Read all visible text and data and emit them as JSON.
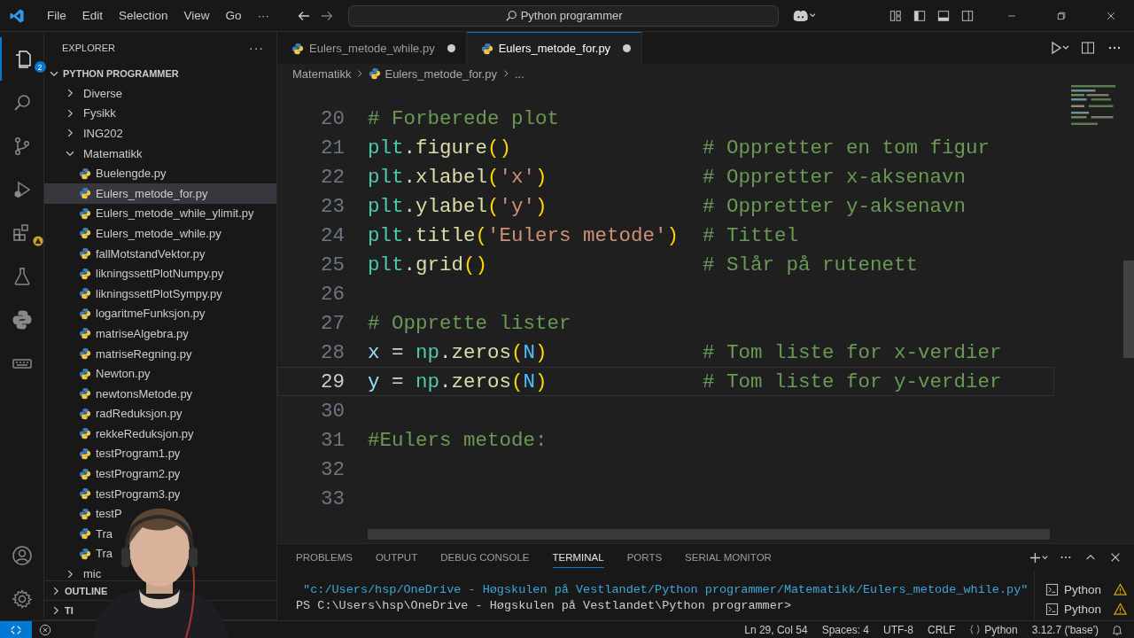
{
  "menu": [
    "File",
    "Edit",
    "Selection",
    "View",
    "Go",
    "···"
  ],
  "search": {
    "value": "Python programmer"
  },
  "activity_bar": {
    "explorer_badge": "2"
  },
  "sidebar": {
    "title": "EXPLORER",
    "more": "···",
    "root": "PYTHON PROGRAMMER",
    "items": [
      {
        "label": "Diverse",
        "kind": "folder",
        "expanded": false,
        "selected": false
      },
      {
        "label": "Fysikk",
        "kind": "folder",
        "expanded": false,
        "selected": false
      },
      {
        "label": "ING202",
        "kind": "folder",
        "expanded": false,
        "selected": false
      },
      {
        "label": "Matematikk",
        "kind": "folder",
        "expanded": true,
        "selected": false,
        "children": [
          {
            "label": "Buelengde.py",
            "kind": "file",
            "selected": false
          },
          {
            "label": "Eulers_metode_for.py",
            "kind": "file",
            "selected": true
          },
          {
            "label": "Eulers_metode_while_ylimit.py",
            "kind": "file",
            "selected": false
          },
          {
            "label": "Eulers_metode_while.py",
            "kind": "file",
            "selected": false
          },
          {
            "label": "fallMotstandVektor.py",
            "kind": "file",
            "selected": false
          },
          {
            "label": "likningssettPlotNumpy.py",
            "kind": "file",
            "selected": false
          },
          {
            "label": "likningssettPlotSympy.py",
            "kind": "file",
            "selected": false
          },
          {
            "label": "logaritmeFunksjon.py",
            "kind": "file",
            "selected": false
          },
          {
            "label": "matriseAlgebra.py",
            "kind": "file",
            "selected": false
          },
          {
            "label": "matriseRegning.py",
            "kind": "file",
            "selected": false
          },
          {
            "label": "Newton.py",
            "kind": "file",
            "selected": false
          },
          {
            "label": "newtonsMetode.py",
            "kind": "file",
            "selected": false
          },
          {
            "label": "radReduksjon.py",
            "kind": "file",
            "selected": false
          },
          {
            "label": "rekkeReduksjon.py",
            "kind": "file",
            "selected": false
          },
          {
            "label": "testProgram1.py",
            "kind": "file",
            "selected": false
          },
          {
            "label": "testProgram2.py",
            "kind": "file",
            "selected": false
          },
          {
            "label": "testProgram3.py",
            "kind": "file",
            "selected": false
          },
          {
            "label": "testP",
            "kind": "file",
            "selected": false
          },
          {
            "label": "Tra",
            "kind": "file",
            "selected": false
          },
          {
            "label": "Tra",
            "kind": "file",
            "selected": false
          }
        ]
      },
      {
        "label": "mic",
        "kind": "folder",
        "expanded": false,
        "selected": false
      }
    ],
    "sections": [
      "OUTLINE",
      "TI"
    ]
  },
  "tabs": [
    {
      "label": "Eulers_metode_while.py",
      "selected": false,
      "dirty": true
    },
    {
      "label": "Eulers_metode_for.py",
      "selected": true,
      "dirty": true
    }
  ],
  "breadcrumbs": [
    "Matematikk",
    "Eulers_metode_for.py",
    "..."
  ],
  "code": [
    {
      "number": "20",
      "current": false,
      "tokens": [
        {
          "kind": "comment",
          "text": "# Forberede plot"
        }
      ]
    },
    {
      "number": "21",
      "current": false,
      "tokens": [
        {
          "kind": "module",
          "text": "plt"
        },
        {
          "kind": "plain",
          "text": "."
        },
        {
          "kind": "func",
          "text": "figure"
        },
        {
          "kind": "paren",
          "text": "()"
        }
      ],
      "comment": "# Oppretter en tom figur"
    },
    {
      "number": "22",
      "current": false,
      "tokens": [
        {
          "kind": "module",
          "text": "plt"
        },
        {
          "kind": "plain",
          "text": "."
        },
        {
          "kind": "func",
          "text": "xlabel"
        },
        {
          "kind": "paren",
          "text": "("
        },
        {
          "kind": "string",
          "text": "'x'"
        },
        {
          "kind": "paren",
          "text": ")"
        }
      ],
      "comment": "# Oppretter x-aksenavn"
    },
    {
      "number": "23",
      "current": false,
      "tokens": [
        {
          "kind": "module",
          "text": "plt"
        },
        {
          "kind": "plain",
          "text": "."
        },
        {
          "kind": "func",
          "text": "ylabel"
        },
        {
          "kind": "paren",
          "text": "("
        },
        {
          "kind": "string",
          "text": "'y'"
        },
        {
          "kind": "paren",
          "text": ")"
        }
      ],
      "comment": "# Oppretter y-aksenavn"
    },
    {
      "number": "24",
      "current": false,
      "tokens": [
        {
          "kind": "module",
          "text": "plt"
        },
        {
          "kind": "plain",
          "text": "."
        },
        {
          "kind": "func",
          "text": "title"
        },
        {
          "kind": "paren",
          "text": "("
        },
        {
          "kind": "string",
          "text": "'Eulers metode'"
        },
        {
          "kind": "paren",
          "text": ")"
        }
      ],
      "comment": "# Tittel"
    },
    {
      "number": "25",
      "current": false,
      "tokens": [
        {
          "kind": "module",
          "text": "plt"
        },
        {
          "kind": "plain",
          "text": "."
        },
        {
          "kind": "func",
          "text": "grid"
        },
        {
          "kind": "paren",
          "text": "()"
        }
      ],
      "comment": "# Slår på rutenett"
    },
    {
      "number": "26",
      "current": false
    },
    {
      "number": "27",
      "current": false,
      "tokens": [
        {
          "kind": "comment",
          "text": "# Opprette lister"
        }
      ]
    },
    {
      "number": "28",
      "current": false,
      "tokens": [
        {
          "kind": "var",
          "text": "x"
        },
        {
          "kind": "plain",
          "text": " = "
        },
        {
          "kind": "module",
          "text": "np"
        },
        {
          "kind": "plain",
          "text": "."
        },
        {
          "kind": "func",
          "text": "zeros"
        },
        {
          "kind": "paren",
          "text": "("
        },
        {
          "kind": "const",
          "text": "N"
        },
        {
          "kind": "paren",
          "text": ")"
        }
      ],
      "comment": "# Tom liste for x-verdier"
    },
    {
      "number": "29",
      "current": true,
      "tokens": [
        {
          "kind": "var",
          "text": "y"
        },
        {
          "kind": "plain",
          "text": " = "
        },
        {
          "kind": "module",
          "text": "np"
        },
        {
          "kind": "plain",
          "text": "."
        },
        {
          "kind": "func",
          "text": "zeros"
        },
        {
          "kind": "paren",
          "text": "("
        },
        {
          "kind": "const",
          "text": "N"
        },
        {
          "kind": "paren",
          "text": ")"
        }
      ],
      "comment": "# Tom liste for y-verdier"
    },
    {
      "number": "30",
      "current": false
    },
    {
      "number": "31",
      "current": false,
      "tokens": [
        {
          "kind": "comment",
          "text": "#Eulers metode:"
        }
      ]
    },
    {
      "number": "32",
      "current": false
    },
    {
      "number": "33",
      "current": false
    }
  ],
  "panel": {
    "tabs": [
      {
        "label": "PROBLEMS",
        "selected": false
      },
      {
        "label": "OUTPUT",
        "selected": false
      },
      {
        "label": "DEBUG CONSOLE",
        "selected": false
      },
      {
        "label": "TERMINAL",
        "selected": true
      },
      {
        "label": "PORTS",
        "selected": false
      },
      {
        "label": "SERIAL MONITOR",
        "selected": false
      }
    ],
    "terminal": [
      {
        "kind": "path",
        "text": " \"c:/Users/hsp/OneDrive - Høgskulen på Vestlandet/Python programmer/Matematikk/Eulers_metode_while.py\""
      },
      {
        "kind": "prompt",
        "text": "PS C:\\Users\\hsp\\OneDrive - Høgskulen på Vestlandet\\Python programmer>"
      }
    ],
    "terminals": [
      "Python",
      "Python"
    ]
  },
  "status_bar": {
    "position": "Ln 29, Col 54",
    "indent": "Spaces: 4",
    "encoding": "UTF-8",
    "eol": "CRLF",
    "language": "Python",
    "interpreter": "3.12.7 ('base')"
  }
}
